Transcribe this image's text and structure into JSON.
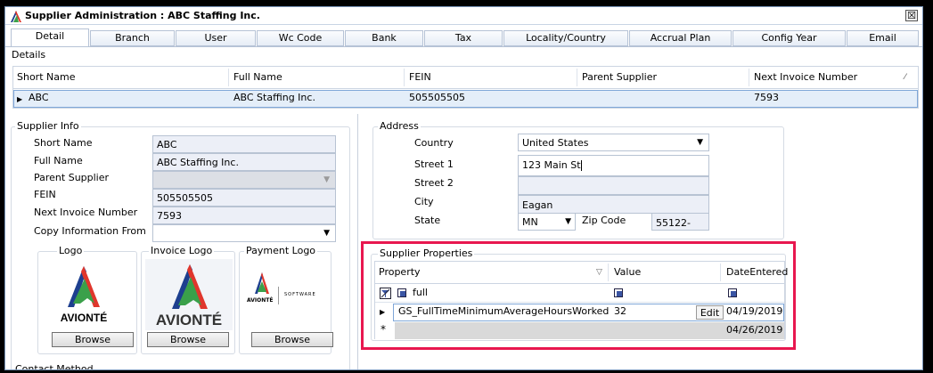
{
  "window": {
    "title": "Supplier Administration : ABC Staffing Inc.",
    "close_glyph": "☒"
  },
  "tabs": [
    "Detail",
    "Branch",
    "User",
    "Wc Code",
    "Bank",
    "Tax",
    "Locality/Country",
    "Accrual Plan",
    "Config Year",
    "Email"
  ],
  "details": {
    "label": "Details",
    "columns": [
      "Short Name",
      "Full Name",
      "FEIN",
      "Parent Supplier",
      "Next Invoice Number"
    ],
    "row": [
      "ABC",
      "ABC Staffing Inc.",
      "505505505",
      "",
      "7593"
    ]
  },
  "supplier_info": {
    "label": "Supplier Info",
    "short_name_label": "Short Name",
    "short_name": "ABC",
    "full_name_label": "Full Name",
    "full_name": "ABC Staffing Inc.",
    "parent_supplier_label": "Parent Supplier",
    "parent_supplier": "",
    "fein_label": "FEIN",
    "fein": "505505505",
    "next_invoice_label": "Next Invoice Number",
    "next_invoice": "7593",
    "copy_from_label": "Copy Information From",
    "copy_from": ""
  },
  "logos": {
    "logo_label": "Logo",
    "invoice_logo_label": "Invoice Logo",
    "payment_logo_label": "Payment Logo",
    "browse": "Browse",
    "brand": "AVIONTÉ",
    "brand_small": "AVIONTÉ",
    "software": "SOFTWARE"
  },
  "address": {
    "label": "Address",
    "country_label": "Country",
    "country": "United States",
    "street1_label": "Street 1",
    "street1": "123 Main St",
    "street2_label": "Street 2",
    "street2": "",
    "city_label": "City",
    "city": "Eagan",
    "state_label": "State",
    "state": "MN",
    "zip_label": "Zip Code",
    "zip": "55122-"
  },
  "supplier_properties": {
    "label": "Supplier Properties",
    "columns": [
      "Property",
      "Value",
      "DateEntered"
    ],
    "filter_value": "full",
    "rows": [
      {
        "property": "GS_FullTimeMinimumAverageHoursWorked",
        "value": "32",
        "edit": "Edit",
        "date": "04/19/2019"
      }
    ],
    "new_row_date": "04/26/2019",
    "highlight_color": "#e8174f"
  },
  "contact_method": {
    "label": "Contact Method"
  }
}
